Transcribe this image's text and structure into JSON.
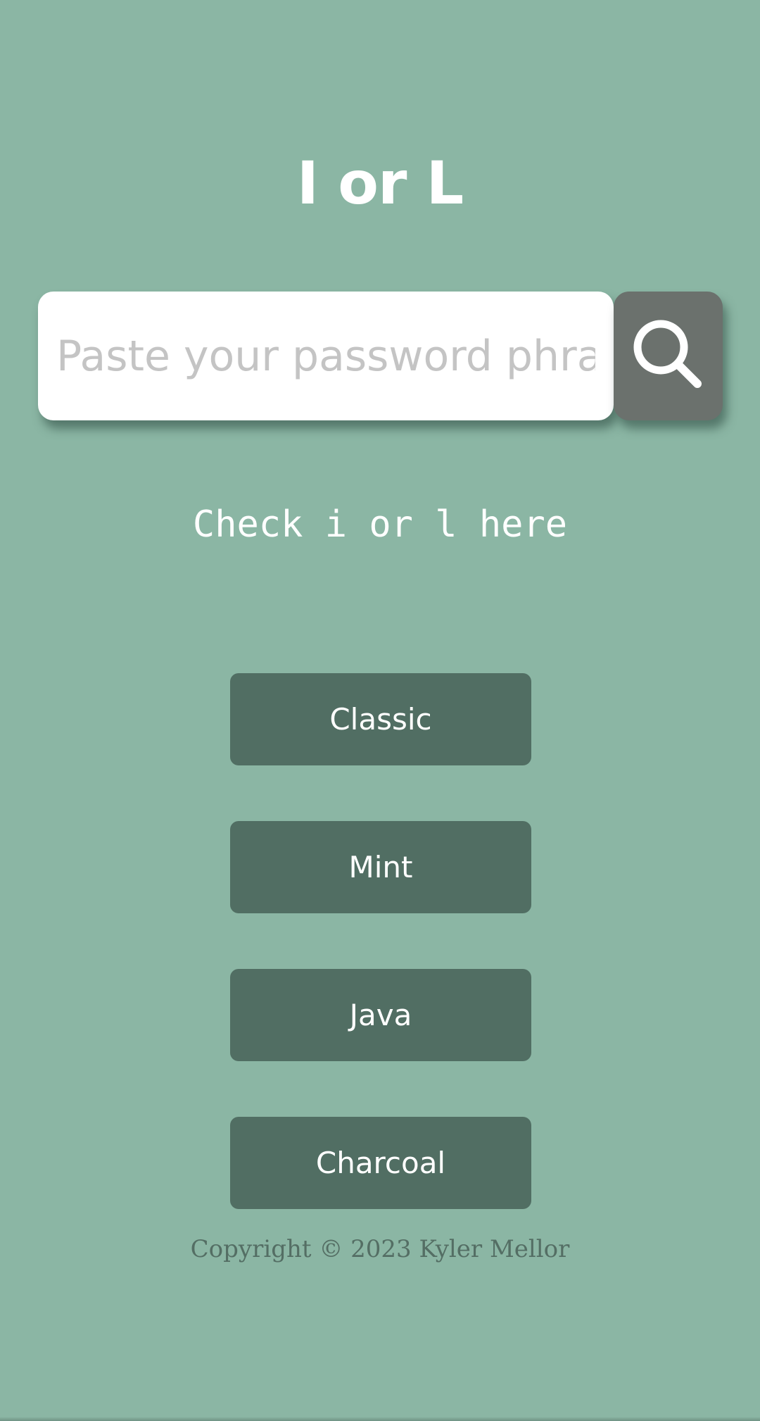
{
  "header": {
    "title": "I or L"
  },
  "search": {
    "placeholder": "Paste your password phrase",
    "value": "",
    "button_icon": "search-icon"
  },
  "hint": {
    "text": "Check i or l here"
  },
  "themes": [
    {
      "label": "Classic"
    },
    {
      "label": "Mint"
    },
    {
      "label": "Java"
    },
    {
      "label": "Charcoal"
    }
  ],
  "footer": {
    "copyright": "Copyright © 2023 Kyler Mellor"
  },
  "colors": {
    "background": "#8bb6a4",
    "button": "#516e63",
    "search_button": "#6b716d",
    "input": "#ffffff"
  }
}
